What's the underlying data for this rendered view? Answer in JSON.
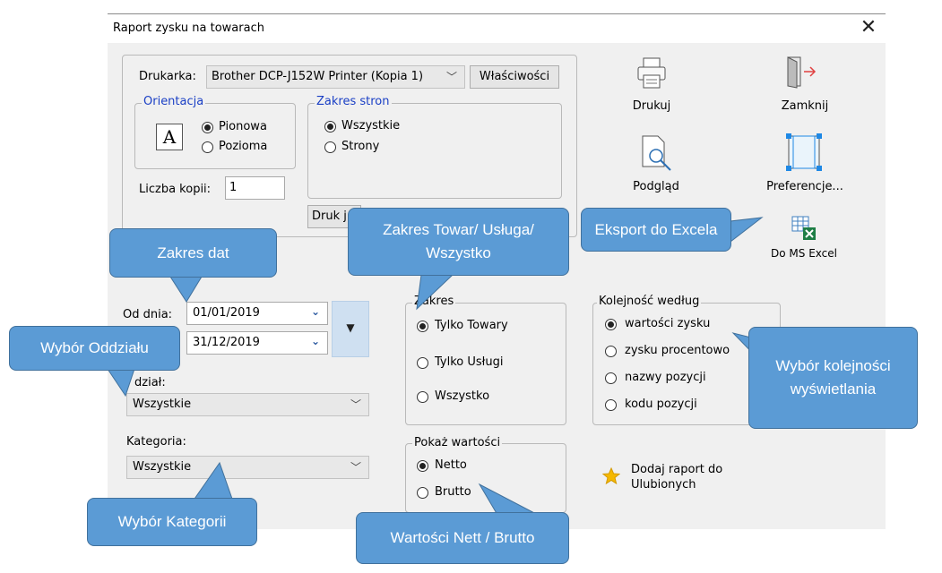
{
  "window": {
    "title": "Raport zysku na towarach"
  },
  "print": {
    "printer_label": "Drukarka:",
    "printer_value": "Brother DCP-J152W Printer (Kopia 1)",
    "properties_button": "Właściwości",
    "orientation_legend": "Orientacja",
    "orientation_portrait": "Pionowa",
    "orientation_landscape": "Pozioma",
    "orientation_icon_letter": "A",
    "range_legend": "Zakres stron",
    "range_all": "Wszystkie",
    "range_pages": "Strony",
    "copies_label": "Liczba kopii:",
    "copies_value": "1",
    "druk_button": "Druk j"
  },
  "toolbar": {
    "print": "Drukuj",
    "close": "Zamknij",
    "preview": "Podgląd",
    "preferences": "Preferencje...",
    "excel": "Do MS Excel"
  },
  "filters": {
    "from_label": "Od dnia:",
    "from_value": "01/01/2019",
    "to_value": "31/12/2019",
    "branch_label": "dział:",
    "branch_value": "Wszystkie",
    "category_label": "Kategoria:",
    "category_value": "Wszystkie"
  },
  "scope": {
    "legend": "Zakres",
    "only_goods": "Tylko Towary",
    "only_services": "Tylko Usługi",
    "all": "Wszystko",
    "selected": "only_goods"
  },
  "values": {
    "legend": "Pokaż wartości",
    "net": "Netto",
    "gross": "Brutto",
    "selected": "net"
  },
  "order": {
    "legend": "Kolejność według",
    "profit_value": "wartości zysku",
    "profit_percent": "zysku procentowo",
    "item_name": "nazwy pozycji",
    "item_code": "kodu pozycji",
    "selected": "profit_value"
  },
  "favorites": {
    "line1": "Dodaj raport do",
    "line2": "Ulubionych"
  },
  "callouts": {
    "date_range": "Zakres dat",
    "scope": "Zakres Towar/ Usługa/ Wszystko",
    "excel": "Eksport do Excela",
    "branch": "Wybór Oddziału",
    "order": "Wybór kolejności wyświetlania",
    "category": "Wybór Kategorii",
    "values": "Wartości Nett / Brutto"
  },
  "colors": {
    "callout_fill": "#5b9bd5",
    "callout_border": "#41719c",
    "dialog_bg": "#f0f0f0",
    "legend_blue": "#1a3fc5"
  }
}
